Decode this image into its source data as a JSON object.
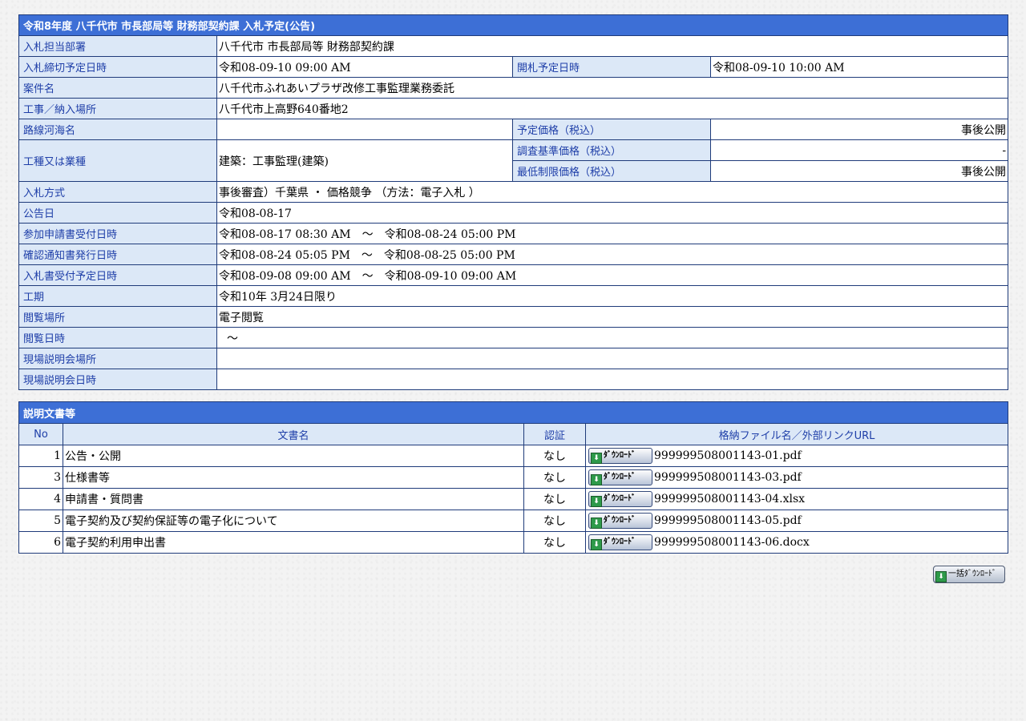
{
  "header": {
    "title": "令和8年度 八千代市  市長部局等  財務部契約課  入札予定(公告)"
  },
  "fields": {
    "dept_label": "入札担当部署",
    "dept": "八千代市  市長部局等  財務部契約課",
    "deadline_label": "入札締切予定日時",
    "deadline": "令和08-09-10 09:00 AM",
    "opening_label": "開札予定日時",
    "opening": "令和08-09-10 10:00 AM",
    "project_label": "案件名",
    "project": "八千代市ふれあいプラザ改修工事監理業務委託",
    "location_label": "工事／納入場所",
    "location": "八千代市上高野640番地2",
    "route_label": "路線河海名",
    "route": "",
    "price_label": "予定価格（税込）",
    "price": "事後公開",
    "category_label": "工種又は業種",
    "category": "建築：工事監理(建築)",
    "survey_price_label": "調査基準価格（税込）",
    "survey_price": "-",
    "min_price_label": "最低制限価格（税込）",
    "min_price": "事後公開",
    "method_label": "入札方式",
    "method": "事後審査）千葉県 ・ 価格競争 （方法：電子入札 ）",
    "notice_date_label": "公告日",
    "notice_date": "令和08-08-17",
    "application_label": "参加申請書受付日時",
    "application": "令和08-08-17 08:30 AM　～　令和08-08-24 05:00 PM",
    "confirm_label": "確認通知書発行日時",
    "confirm": "令和08-08-24 05:05 PM　～　令和08-08-25 05:00 PM",
    "bid_receipt_label": "入札書受付予定日時",
    "bid_receipt": "令和08-09-08 09:00 AM　～　令和08-09-10 09:00 AM",
    "period_label": "工期",
    "period": "令和10年 3月24日限り",
    "view_place_label": "閲覧場所",
    "view_place": "電子閲覧",
    "view_date_label": "閲覧日時",
    "view_date": "～",
    "site_place_label": "現場説明会場所",
    "site_place": "",
    "site_date_label": "現場説明会日時",
    "site_date": ""
  },
  "documents": {
    "title": "説明文書等",
    "columns": {
      "no": "No",
      "name": "文書名",
      "auth": "認証",
      "file": "格納ファイル名／外部リンクURL"
    },
    "download_label": "ﾀﾞｳﾝﾛｰﾄﾞ",
    "rows": [
      {
        "no": "1",
        "name": "公告・公開",
        "auth": "なし",
        "file": "999999508001143-01.pdf"
      },
      {
        "no": "3",
        "name": "仕様書等",
        "auth": "なし",
        "file": "999999508001143-03.pdf"
      },
      {
        "no": "4",
        "name": "申請書・質問書",
        "auth": "なし",
        "file": "999999508001143-04.xlsx"
      },
      {
        "no": "5",
        "name": "電子契約及び契約保証等の電子化について",
        "auth": "なし",
        "file": "999999508001143-05.pdf"
      },
      {
        "no": "6",
        "name": "電子契約利用申出書",
        "auth": "なし",
        "file": "999999508001143-06.docx"
      }
    ]
  },
  "bulk_download_label": "一括ﾀﾞｳﾝﾛｰﾄﾞ",
  "icons": {
    "download": "download-arrow-icon"
  }
}
